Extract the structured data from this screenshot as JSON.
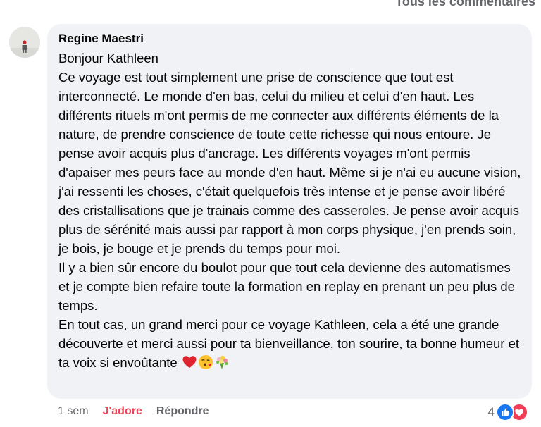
{
  "header": {
    "all_comments_link": "Tous les commentaires"
  },
  "comment": {
    "author": "Regine Maestri",
    "paragraphs": [
      "Bonjour Kathleen",
      "Ce voyage est tout simplement une prise de conscience que tout est interconnecté. Le monde d'en bas, celui du milieu et celui d'en haut. Les différents rituels m'ont permis de me connecter aux différents éléments de la nature, de prendre conscience de toute cette richesse qui nous entoure. Je pense avoir acquis plus d'ancrage. Les différents voyages m'ont permis d'apaiser mes peurs face au monde d'en haut. Même si je n'ai eu aucune vision, j'ai ressenti les choses, c'était quelquefois très intense et je pense avoir libéré des cristallisations que je trainais comme des casseroles. Je pense avoir acquis plus de sérénité mais aussi par rapport à mon corps physique, j'en prends soin, je bois, je bouge et je prends du temps pour moi.",
      "Il y a bien sûr encore du boulot pour que tout cela devienne des automatismes et je compte bien refaire toute la formation en replay en prenant un peu plus de temps.",
      "En tout cas, un grand merci pour ce voyage Kathleen, cela a été une grande découverte et merci aussi pour ta bienveillance, ton sourire, ta bonne humeur et ta voix si envoûtante"
    ],
    "emojis": [
      "red-heart-icon",
      "face-blowing-kiss-icon",
      "bouquet-icon"
    ]
  },
  "actions": {
    "time": "1 sem",
    "like_label": "J'adore",
    "reply_label": "Répondre"
  },
  "reactions": {
    "count": "4",
    "types": [
      "like-reaction-icon",
      "love-reaction-icon"
    ]
  },
  "colors": {
    "bubble": "#f0f2f5",
    "secondary_text": "#65676b",
    "love": "#f33e58",
    "like": "#1877f2"
  }
}
